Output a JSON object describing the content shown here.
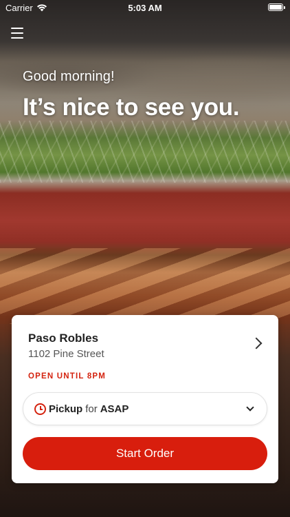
{
  "status_bar": {
    "carrier": "Carrier",
    "time": "5:03 AM"
  },
  "hero": {
    "greeting": "Good morning!",
    "headline": "It’s nice to see you."
  },
  "store": {
    "name": "Paso Robles",
    "address": "1102 Pine Street",
    "hours": "OPEN UNTIL 8PM"
  },
  "order_type": {
    "mode": "Pickup",
    "connector": "for",
    "time": "ASAP"
  },
  "actions": {
    "start_order_label": "Start Order"
  },
  "colors": {
    "accent": "#d81e0d",
    "hours_text": "#d4230f",
    "card_background": "#ffffff"
  },
  "icons": [
    "wifi-icon",
    "battery-icon",
    "menu-icon",
    "chevron-right-icon",
    "clock-icon",
    "chevron-down-icon"
  ]
}
